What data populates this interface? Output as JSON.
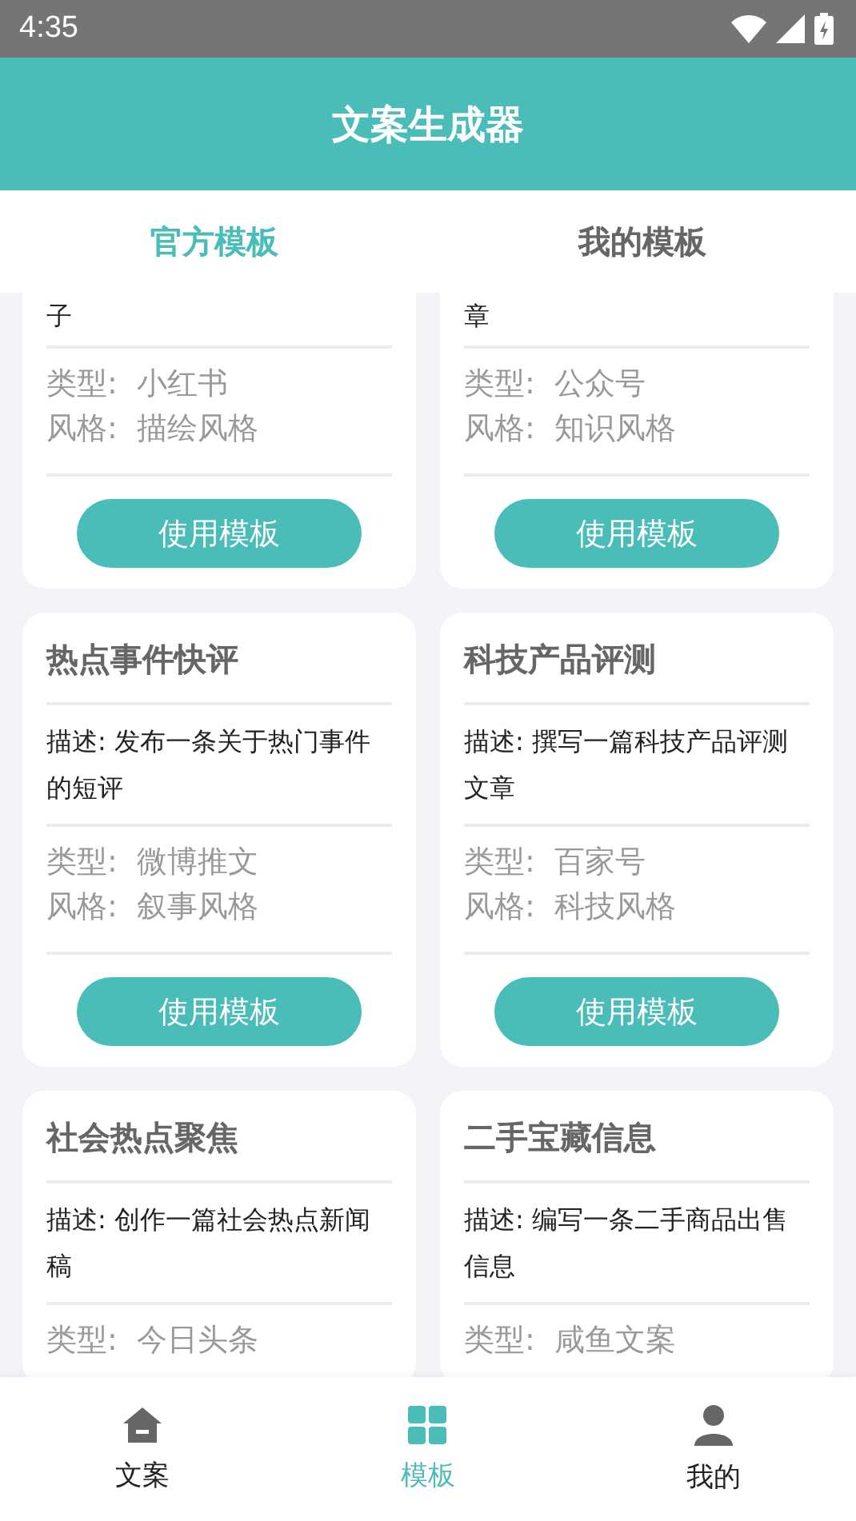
{
  "status_bar": {
    "time": "4:35"
  },
  "app_bar": {
    "title": "文案生成器"
  },
  "tabs": [
    {
      "label": "官方模板",
      "selected": true
    },
    {
      "label": "我的模板",
      "selected": false
    }
  ],
  "cards": [
    {
      "description": "子",
      "type": "类型:  小红书",
      "style": "风格:  描绘风格",
      "button": "使用模板"
    },
    {
      "description": "章",
      "type": "类型:  公众号",
      "style": "风格:  知识风格",
      "button": "使用模板"
    },
    {
      "title": "热点事件快评",
      "description": "描述: 发布一条关于热门事件的短评",
      "type": "类型:  微博推文",
      "style": "风格:  叙事风格",
      "button": "使用模板"
    },
    {
      "title": "科技产品评测",
      "description": "描述: 撰写一篇科技产品评测文章",
      "type": "类型:  百家号",
      "style": "风格:  科技风格",
      "button": "使用模板"
    },
    {
      "title": "社会热点聚焦",
      "description": "描述: 创作一篇社会热点新闻稿",
      "type": "类型:  今日头条"
    },
    {
      "title": "二手宝藏信息",
      "description": "描述: 编写一条二手商品出售信息",
      "type": "类型:  咸鱼文案"
    }
  ],
  "bottom_nav": [
    {
      "kind": "home",
      "label": "文案",
      "selected": false
    },
    {
      "kind": "grid",
      "label": "模板",
      "selected": true
    },
    {
      "kind": "person",
      "label": "我的",
      "selected": false
    }
  ]
}
